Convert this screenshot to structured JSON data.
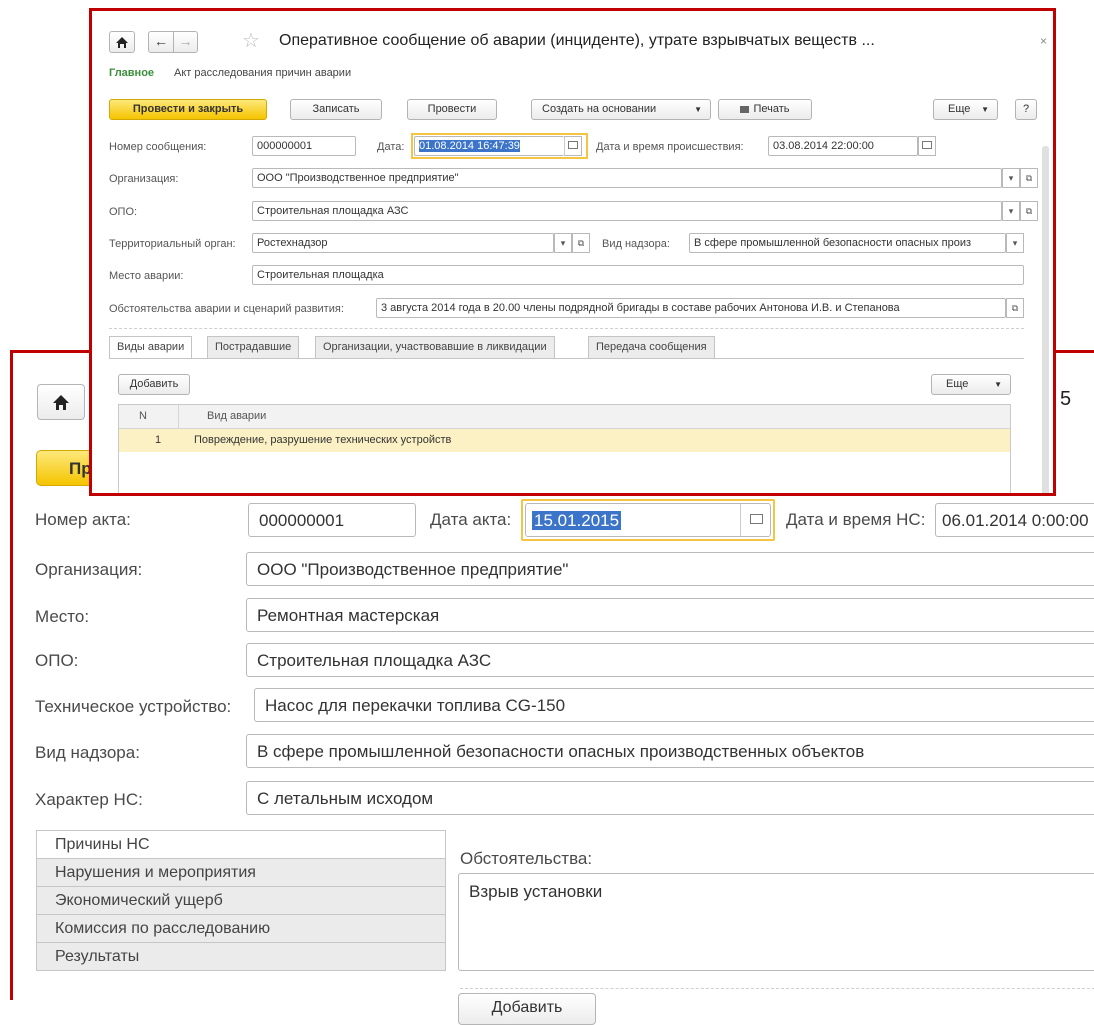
{
  "back": {
    "right_edge_digit": "5",
    "primary_button_partial": "Пр",
    "fields": {
      "act_number": {
        "label": "Номер акта:",
        "value": "000000001"
      },
      "act_date": {
        "label": "Дата акта:",
        "value": "15.01.2015"
      },
      "ns_datetime": {
        "label": "Дата и время НС:",
        "value": "06.01.2014  0:00:00"
      },
      "organization": {
        "label": "Организация:",
        "value": "ООО \"Производственное предприятие\""
      },
      "place": {
        "label": "Место:",
        "value": "Ремонтная мастерская"
      },
      "opo": {
        "label": "ОПО:",
        "value": "Строительная площадка АЗС"
      },
      "device": {
        "label": "Техническое устройство:",
        "value": "Насос для перекачки топлива CG-150"
      },
      "supervision": {
        "label": "Вид надзора:",
        "value": "В сфере промышленной безопасности опасных производственных объектов"
      },
      "ns_character": {
        "label": "Характер НС:",
        "value": "С летальным исходом"
      }
    },
    "tabs": [
      "Причины НС",
      "Нарушения и мероприятия",
      "Экономический ущерб",
      "Комиссия по расследованию",
      "Результаты"
    ],
    "circumstances": {
      "label": "Обстоятельства:",
      "value": "Взрыв установки"
    },
    "add_button": "Добавить"
  },
  "front": {
    "title": "Оперативное сообщение об аварии (инциденте), утрате взрывчатых веществ ...",
    "nav": {
      "main": "Главное",
      "act": "Акт расследования причин аварии"
    },
    "toolbar": {
      "post_close": "Провести и закрыть",
      "save": "Записать",
      "post": "Провести",
      "create_based": "Создать на основании",
      "print": "Печать",
      "more": "Еще",
      "help": "?"
    },
    "fields": {
      "msg_number": {
        "label": "Номер сообщения:",
        "value": "000000001"
      },
      "date": {
        "label": "Дата:",
        "value": "01.08.2014 16:47:39"
      },
      "incident_dt": {
        "label": "Дата и время происшествия:",
        "value": "03.08.2014 22:00:00"
      },
      "organization": {
        "label": "Организация:",
        "value": "ООО \"Производственное предприятие\""
      },
      "opo": {
        "label": "ОПО:",
        "value": "Строительная площадка АЗС"
      },
      "territorial": {
        "label": "Территориальный орган:",
        "value": "Ростехнадзор"
      },
      "supervision": {
        "label": "Вид надзора:",
        "value": "В сфере промышленной безопасности опасных произ"
      },
      "place": {
        "label": "Место аварии:",
        "value": "Строительная площадка"
      },
      "circumstances": {
        "label": "Обстоятельства аварии и сценарий развития:",
        "value": "3 августа 2014 года в 20.00 члены подрядной бригады в составе рабочих Антонова И.В. и Степанова"
      }
    },
    "tabs": [
      "Виды аварии",
      "Пострадавшие",
      "Организации, участвовавшие в ликвидации",
      "Передача сообщения"
    ],
    "table": {
      "add": "Добавить",
      "more": "Еще",
      "columns": [
        "N",
        "Вид аварии"
      ],
      "rows": [
        {
          "n": "1",
          "kind": "Повреждение, разрушение технических устройств"
        }
      ]
    }
  }
}
